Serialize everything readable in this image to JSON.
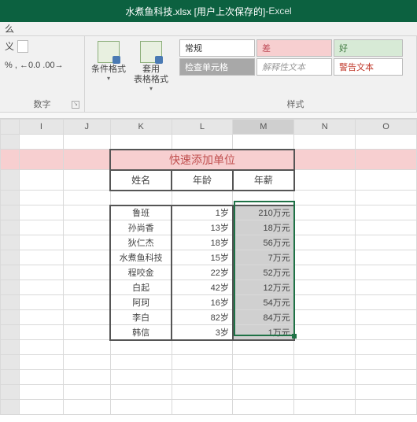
{
  "window": {
    "title": "水煮鱼科技.xlsx [用户上次保存的]",
    "app": "Excel",
    "sep": " - "
  },
  "ribbon": {
    "tab_hint": "么",
    "number": {
      "custom": "义",
      "percent": "%",
      "comma": ",",
      "inc": "←0",
      "dec": "→0",
      "pctrow": "% , ←0.0 .00→",
      "label": "数字"
    },
    "cond": {
      "label1": "条件格式",
      "drop": "▾"
    },
    "table": {
      "label1": "套用",
      "label2": "表格格式",
      "drop": "▾"
    },
    "styles": {
      "normal": "常规",
      "bad": "差",
      "good": "好",
      "check": "检查单元格",
      "explain": "解释性文本",
      "warn": "警告文本",
      "label": "样式"
    }
  },
  "cols": {
    "I": "I",
    "J": "J",
    "K": "K",
    "L": "L",
    "M": "M",
    "N": "N",
    "O": "O"
  },
  "table_block": {
    "title": "快速添加单位",
    "h_name": "姓名",
    "h_age": "年龄",
    "h_sal": "年薪",
    "rows": [
      {
        "name": "鲁班",
        "age": "1岁",
        "sal": "210万元"
      },
      {
        "name": "孙尚香",
        "age": "13岁",
        "sal": "18万元"
      },
      {
        "name": "狄仁杰",
        "age": "18岁",
        "sal": "56万元"
      },
      {
        "name": "水煮鱼科技",
        "age": "15岁",
        "sal": "7万元"
      },
      {
        "name": "程咬金",
        "age": "22岁",
        "sal": "52万元"
      },
      {
        "name": "白起",
        "age": "42岁",
        "sal": "12万元"
      },
      {
        "name": "阿珂",
        "age": "16岁",
        "sal": "54万元"
      },
      {
        "name": "李白",
        "age": "82岁",
        "sal": "84万元"
      },
      {
        "name": "韩信",
        "age": "3岁",
        "sal": "1万元"
      }
    ]
  }
}
